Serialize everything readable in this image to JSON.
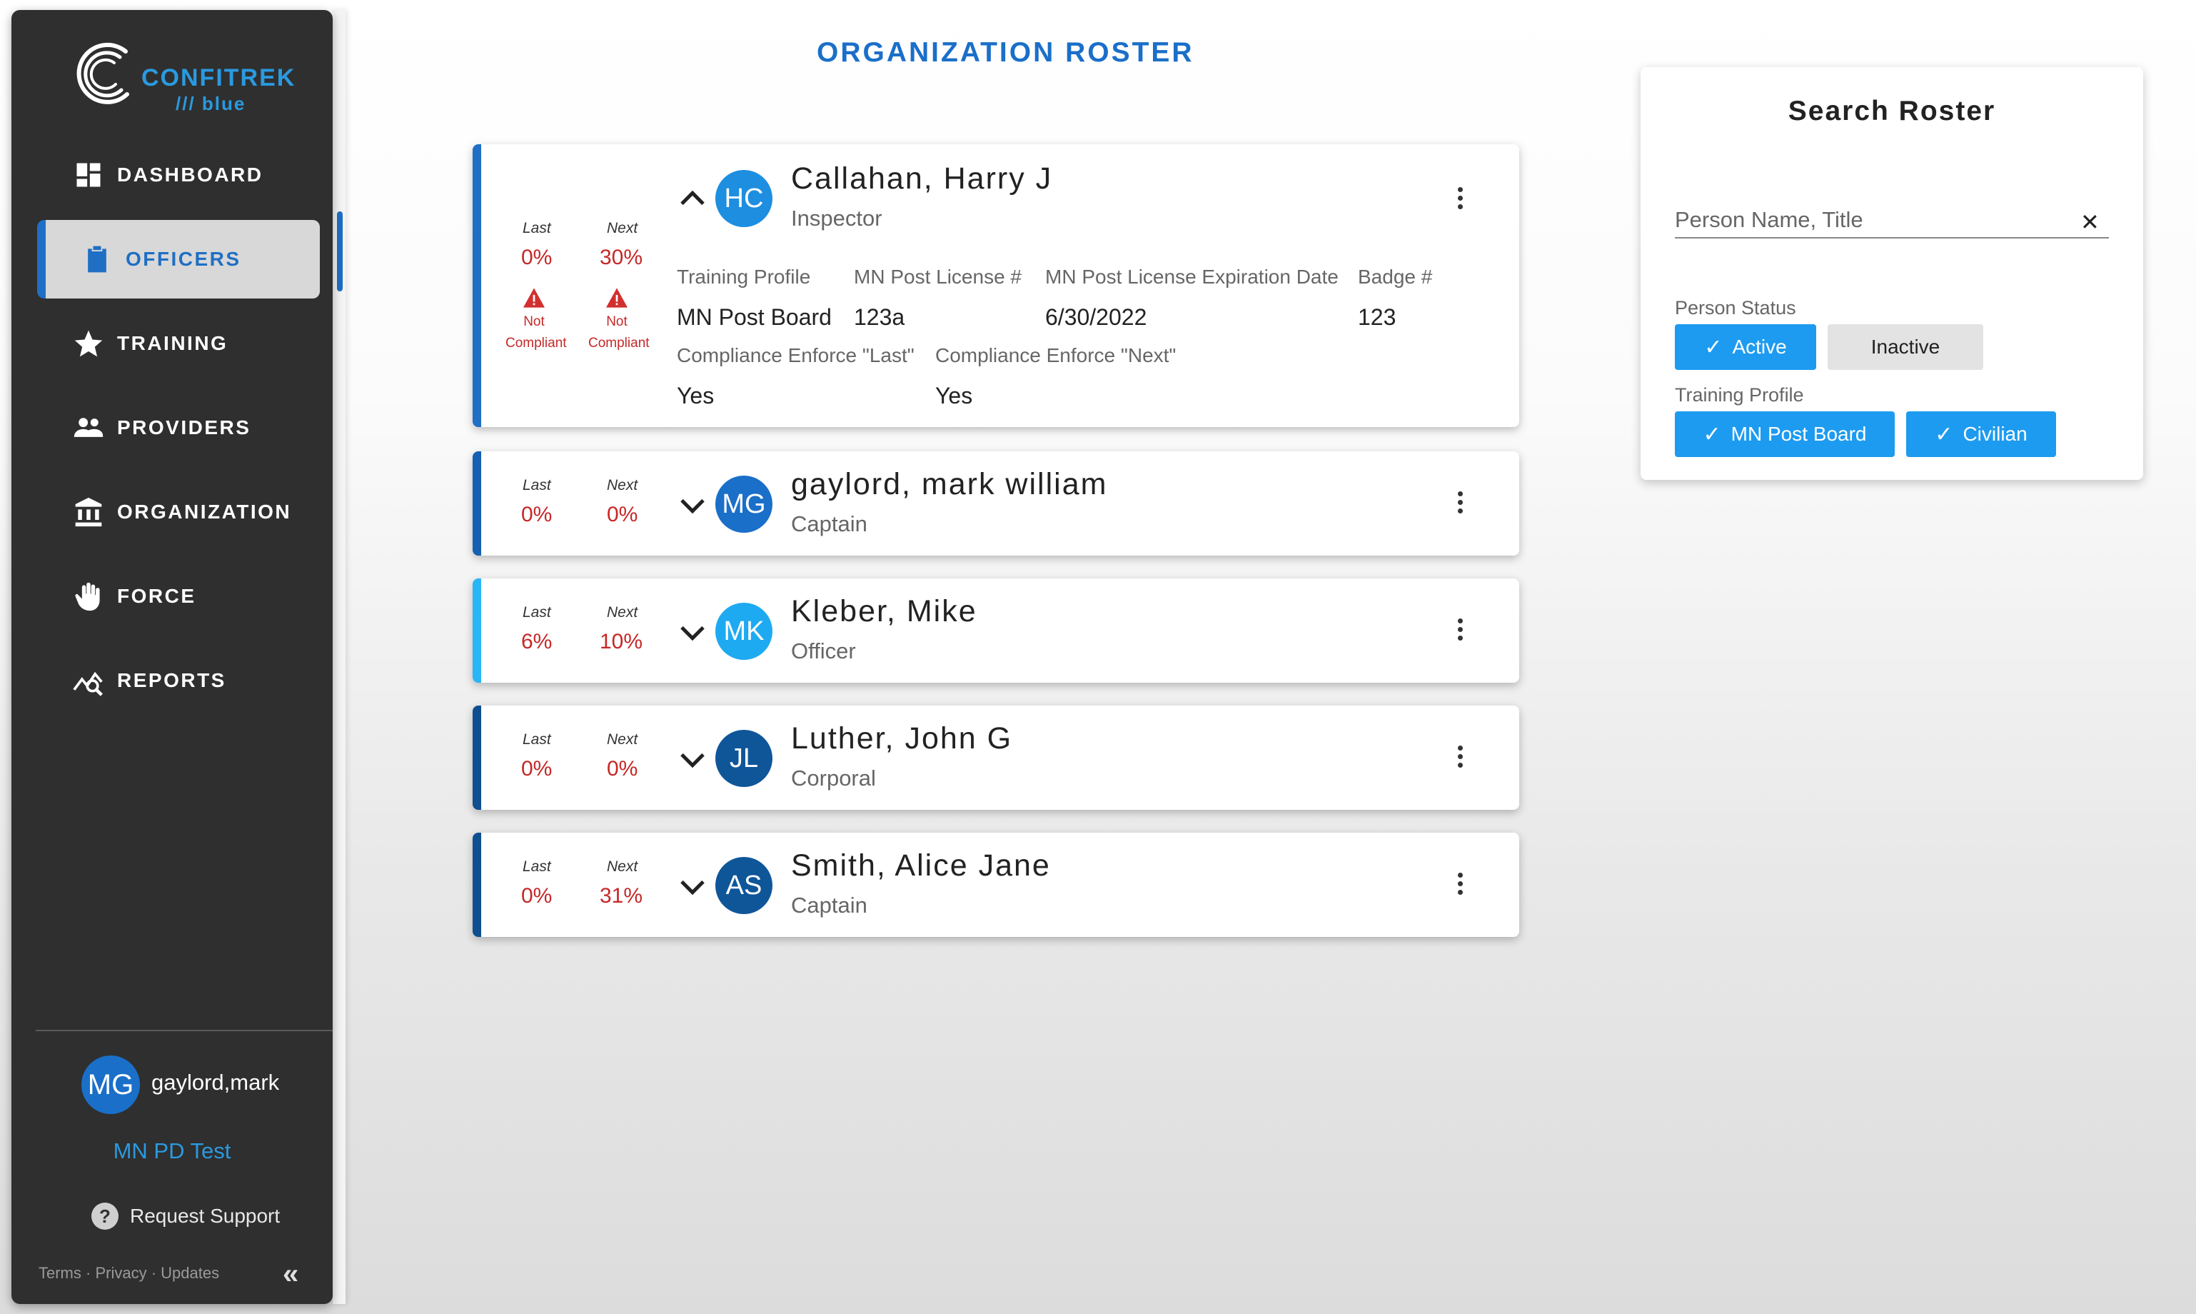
{
  "brand": {
    "name": "CONFITREK",
    "sub": "/// blue"
  },
  "nav": [
    {
      "label": "DASHBOARD",
      "icon": "dashboard-icon"
    },
    {
      "label": "OFFICERS",
      "icon": "clipboard-icon"
    },
    {
      "label": "TRAINING",
      "icon": "star-icon"
    },
    {
      "label": "PROVIDERS",
      "icon": "people-icon"
    },
    {
      "label": "ORGANIZATION",
      "icon": "bank-icon"
    },
    {
      "label": "FORCE",
      "icon": "hand-icon"
    },
    {
      "label": "REPORTS",
      "icon": "chart-search-icon"
    }
  ],
  "user": {
    "initials": "MG",
    "name": "gaylord,mark",
    "org": "MN PD Test"
  },
  "support_label": "Request Support",
  "footer": {
    "terms": "Terms",
    "privacy": "Privacy",
    "updates": "Updates",
    "sep": "·"
  },
  "page_title": "ORGANIZATION ROSTER",
  "colors": {
    "accent": "#1a6fc9",
    "bright": "#1d9bf0",
    "alert": "#c62828",
    "sidebar": "#2f2f2f"
  },
  "roster": {
    "last_label": "Last",
    "next_label": "Next",
    "not_compliant": [
      "Not",
      "Compliant"
    ],
    "officers": [
      {
        "initials": "HC",
        "name": "Callahan, Harry J",
        "title": "Inspector",
        "last": "0%",
        "next": "30%",
        "expanded": true,
        "details": {
          "training_profile_h": "Training Profile",
          "training_profile": "MN Post Board",
          "license_h": "MN Post License #",
          "license": "123a",
          "expiration_h": "MN Post License Expiration Date",
          "expiration": "6/30/2022",
          "badge_h": "Badge #",
          "badge": "123",
          "enforce_last_h": "Compliance Enforce \"Last\"",
          "enforce_last": "Yes",
          "enforce_next_h": "Compliance Enforce \"Next\"",
          "enforce_next": "Yes"
        }
      },
      {
        "initials": "MG",
        "name": "gaylord, mark william",
        "title": "Captain",
        "last": "0%",
        "next": "0%"
      },
      {
        "initials": "MK",
        "name": "Kleber, Mike",
        "title": "Officer",
        "last": "6%",
        "next": "10%"
      },
      {
        "initials": "JL",
        "name": "Luther, John G",
        "title": "Corporal",
        "last": "0%",
        "next": "0%"
      },
      {
        "initials": "AS",
        "name": "Smith, Alice Jane",
        "title": "Captain",
        "last": "0%",
        "next": "31%"
      }
    ]
  },
  "search": {
    "title": "Search Roster",
    "placeholder": "Person Name, Title",
    "value": "",
    "status_label": "Person Status",
    "status_options": [
      {
        "label": "Active",
        "selected": true
      },
      {
        "label": "Inactive",
        "selected": false
      }
    ],
    "profile_label": "Training Profile",
    "profile_options": [
      {
        "label": "MN Post Board",
        "selected": true
      },
      {
        "label": "Civilian",
        "selected": true
      }
    ]
  }
}
